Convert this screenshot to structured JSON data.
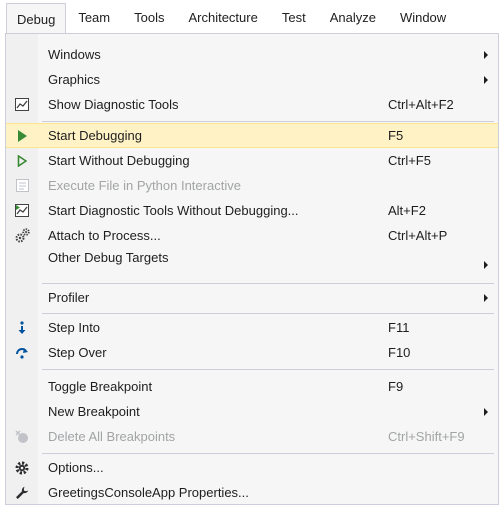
{
  "menubar": {
    "items": [
      "Debug",
      "Team",
      "Tools",
      "Architecture",
      "Test",
      "Analyze",
      "Window"
    ]
  },
  "menu": {
    "items": [
      {
        "label": "Windows",
        "shortcut": "",
        "icon": "",
        "submenu": true
      },
      {
        "label": "Graphics",
        "shortcut": "",
        "icon": "",
        "submenu": true
      },
      {
        "label": "Show Diagnostic Tools",
        "shortcut": "Ctrl+Alt+F2",
        "icon": "diagnostic-tools-icon"
      },
      {
        "label": "Start Debugging",
        "shortcut": "F5",
        "icon": "play-icon",
        "highlighted": true
      },
      {
        "label": "Start Without Debugging",
        "shortcut": "Ctrl+F5",
        "icon": "play-outline-icon"
      },
      {
        "label": "Execute File in Python Interactive",
        "shortcut": "",
        "icon": "python-interactive-icon",
        "disabled": true
      },
      {
        "label": "Start Diagnostic Tools Without Debugging...",
        "shortcut": "Alt+F2",
        "icon": "diagnostic-tools-icon"
      },
      {
        "label": "Attach to Process...",
        "shortcut": "Ctrl+Alt+P",
        "icon": "gears-icon"
      },
      {
        "label": "Other Debug Targets",
        "shortcut": "",
        "icon": "",
        "submenu": true
      },
      {
        "label": "Profiler",
        "shortcut": "",
        "icon": "",
        "submenu": true
      },
      {
        "label": "Step Into",
        "shortcut": "F11",
        "icon": "step-into-icon"
      },
      {
        "label": "Step Over",
        "shortcut": "F10",
        "icon": "step-over-icon"
      },
      {
        "label": "Toggle Breakpoint",
        "shortcut": "F9",
        "icon": ""
      },
      {
        "label": "New Breakpoint",
        "shortcut": "",
        "icon": "",
        "submenu": true
      },
      {
        "label": "Delete All Breakpoints",
        "shortcut": "Ctrl+Shift+F9",
        "icon": "delete-breakpoints-icon",
        "disabled": true
      },
      {
        "label": "Options...",
        "shortcut": "",
        "icon": "gear-icon"
      },
      {
        "label": "GreetingsConsoleApp Properties...",
        "shortcut": "",
        "icon": "wrench-icon"
      }
    ]
  },
  "colors": {
    "highlight": "#fff3c6",
    "accent_green": "#388a34",
    "accent_blue": "#00539c"
  }
}
